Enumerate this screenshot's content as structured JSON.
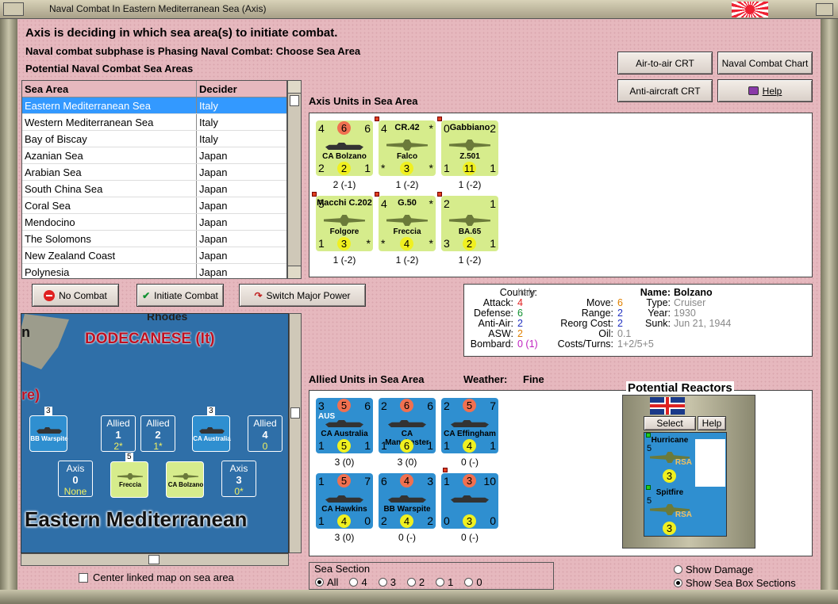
{
  "window": {
    "title": "Naval Combat In Eastern Mediterranean Sea (Axis)"
  },
  "header": {
    "line1": "Axis is deciding in which sea area(s) to initiate combat.",
    "line2": "Naval combat subphase is Phasing Naval Combat: Choose Sea Area",
    "line3": "Potential Naval Combat Sea Areas"
  },
  "buttons": {
    "air_to_air": "Air-to-air CRT",
    "naval_chart": "Naval Combat Chart",
    "anti_aircraft": "Anti-aircraft CRT",
    "help": "Help",
    "no_combat": "No Combat",
    "initiate_combat": "Initiate Combat",
    "switch_major": "Switch Major Power"
  },
  "sea_table": {
    "headers": [
      "Sea Area",
      "Decider"
    ],
    "rows": [
      [
        "Eastern Mediterranean Sea",
        "Italy"
      ],
      [
        "Western Mediterranean Sea",
        "Italy"
      ],
      [
        "Bay of Biscay",
        "Italy"
      ],
      [
        "Azanian Sea",
        "Japan"
      ],
      [
        "Arabian Sea",
        "Japan"
      ],
      [
        "South China Sea",
        "Japan"
      ],
      [
        "Coral Sea",
        "Japan"
      ],
      [
        "Mendocino",
        "Japan"
      ],
      [
        "The Solomons",
        "Japan"
      ],
      [
        "New Zealand Coast",
        "Japan"
      ],
      [
        "Polynesia",
        "Japan"
      ]
    ]
  },
  "axis_section": {
    "label": "Axis Units in Sea Area",
    "units": [
      {
        "tl": "4",
        "tm": "6",
        "tr": "6",
        "name": "CA Bolzano",
        "bl": "2",
        "bm": "2",
        "br": "1",
        "stat": "2 (-1)",
        "kind": "ship"
      },
      {
        "tl": "4",
        "tm": "CR.42",
        "tr": "*",
        "name": "Falco",
        "bl": "*",
        "bm": "3",
        "br": "*",
        "stat": "1 (-2)",
        "kind": "plane"
      },
      {
        "tl": "0",
        "tm": "Gabbiano",
        "tr": "2",
        "name": "Z.501",
        "bl": "1",
        "bm": "11",
        "br": "1",
        "stat": "1 (-2)",
        "kind": "plane"
      },
      {
        "tl": "5",
        "tm": "Macchi C.202",
        "tr": "",
        "name": "Folgore",
        "bl": "1",
        "bm": "3",
        "br": "*",
        "stat": "1 (-2)",
        "kind": "plane"
      },
      {
        "tl": "4",
        "tm": "G.50",
        "tr": "*",
        "name": "Freccia",
        "bl": "*",
        "bm": "4",
        "br": "*",
        "stat": "1 (-2)",
        "kind": "plane"
      },
      {
        "tl": "2",
        "tm": "",
        "tr": "1",
        "name": "BA.65",
        "bl": "3",
        "bm": "2",
        "br": "1",
        "stat": "1 (-2)",
        "kind": "plane"
      }
    ]
  },
  "info": {
    "country_label": "Country:",
    "country": "Italy",
    "attack_label": "Attack:",
    "attack": "4",
    "defense_label": "Defense:",
    "defense": "6",
    "anti_air_label": "Anti-Air:",
    "anti_air": "2",
    "asw_label": "ASW:",
    "asw": "2",
    "bombard_label": "Bombard:",
    "bombard": "0 (1)",
    "name_label": "Name:",
    "name": "Bolzano",
    "type_label": "Type:",
    "type": "Cruiser",
    "year_label": "Year:",
    "year": "1930",
    "sunk_label": "Sunk:",
    "sunk": "Jun 21, 1944",
    "move_label": "Move:",
    "move": "6",
    "range_label": "Range:",
    "range": "2",
    "reorg_label": "Reorg Cost:",
    "reorg": "2",
    "oil_label": "Oil:",
    "oil": "0.1",
    "costs_label": "Costs/Turns:",
    "costs": "1+2/5+5"
  },
  "allied_section": {
    "label": "Allied Units in Sea Area",
    "weather_label": "Weather:",
    "weather": "Fine",
    "units": [
      {
        "tl": "3",
        "tm": "5",
        "tr": "6",
        "name": "CA Australia",
        "bl": "1",
        "bm": "5",
        "br": "1",
        "stat": "3 (0)",
        "tag": "AUS"
      },
      {
        "tl": "2",
        "tm": "6",
        "tr": "6",
        "name": "CA Manchester",
        "bl": "1",
        "bm": "6",
        "br": "1",
        "stat": "3 (0)",
        "tag": ""
      },
      {
        "tl": "2",
        "tm": "5",
        "tr": "7",
        "name": "CA Effingham",
        "bl": "1",
        "bm": "4",
        "br": "1",
        "stat": "0 (-)",
        "tag": ""
      },
      {
        "tl": "1",
        "tm": "5",
        "tr": "7",
        "name": "CA Hawkins",
        "bl": "1",
        "bm": "4",
        "br": "0",
        "stat": "3 (0)",
        "tag": ""
      },
      {
        "tl": "6",
        "tm": "4",
        "tr": "3",
        "name": "BB Warspite",
        "bl": "2",
        "bm": "4",
        "br": "2",
        "stat": "0 (-)",
        "tag": ""
      },
      {
        "tl": "1",
        "tm": "3",
        "tr": "10",
        "name": "",
        "bl": "0",
        "bm": "3",
        "br": "0",
        "stat": "0 (-)",
        "tag": ""
      }
    ]
  },
  "reactors": {
    "title": "Potential Reactors",
    "select": "Select",
    "help": "Help",
    "units": [
      {
        "name": "Hurricane",
        "sub": "IIA",
        "tag": "RSA",
        "tl": "5",
        "bm": "3"
      },
      {
        "name": "Spitfire",
        "sub": "",
        "tag": "RSA",
        "tl": "5",
        "bm": "3"
      }
    ]
  },
  "map": {
    "rhodes": "Rhodes",
    "dodecanese": "DODECANESE (It)",
    "frag1": "n",
    "frag2": "re)",
    "sea_name": "Eastern Mediterranean",
    "allied_boxes": [
      {
        "t": "Allied",
        "n1": "1",
        "n2": "2*"
      },
      {
        "t": "Allied",
        "n1": "2",
        "n2": "1*"
      },
      {
        "t": "Allied",
        "n1": "4",
        "n2": "0"
      }
    ],
    "axis_boxes": [
      {
        "t": "Axis",
        "n1": "0",
        "n2": "None"
      },
      {
        "t": "Axis",
        "n1": "3",
        "n2": "0*"
      }
    ],
    "counters": [
      {
        "name": "BB Warspite",
        "stack": "3"
      },
      {
        "name": "CA Australia",
        "stack": "3"
      },
      {
        "name": "Freccia",
        "stack": "5"
      },
      {
        "name": "CA Bolzano",
        "stack": ""
      }
    ]
  },
  "center_linked": "Center linked map on sea area",
  "sea_section": {
    "label": "Sea Section",
    "options": [
      "All",
      "4",
      "3",
      "2",
      "1",
      "0"
    ],
    "selected": "All"
  },
  "show_damage": "Show Damage",
  "show_sections": "Show Sea Box Sections"
}
